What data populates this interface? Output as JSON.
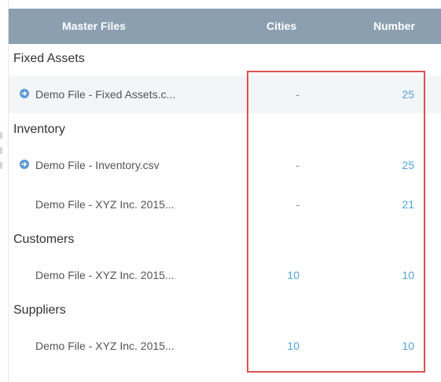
{
  "table": {
    "headers": {
      "master_files": "Master Files",
      "cities": "Cities",
      "number": "Number"
    },
    "groups": [
      {
        "label": "Fixed Assets",
        "rows": [
          {
            "file": "Demo File - Fixed Assets.c...",
            "cities": "-",
            "number": "25",
            "icon": "arrow-circle-right-icon"
          }
        ]
      },
      {
        "label": "Inventory",
        "rows": [
          {
            "file": "Demo File - Inventory.csv",
            "cities": "-",
            "number": "25",
            "icon": "arrow-circle-right-icon"
          },
          {
            "file": "Demo File - XYZ Inc. 2015...",
            "cities": "-",
            "number": "21"
          }
        ]
      },
      {
        "label": "Customers",
        "rows": [
          {
            "file": "Demo File - XYZ Inc. 2015...",
            "cities": "10",
            "number": "10"
          }
        ]
      },
      {
        "label": "Suppliers",
        "rows": [
          {
            "file": "Demo File - XYZ Inc. 2015...",
            "cities": "10",
            "number": "10"
          }
        ]
      }
    ]
  },
  "colors": {
    "header_bg": "#8b9fb1",
    "link": "#4fa3dc",
    "highlight": "#d9534f",
    "row_shade": "#f4f5f7"
  }
}
